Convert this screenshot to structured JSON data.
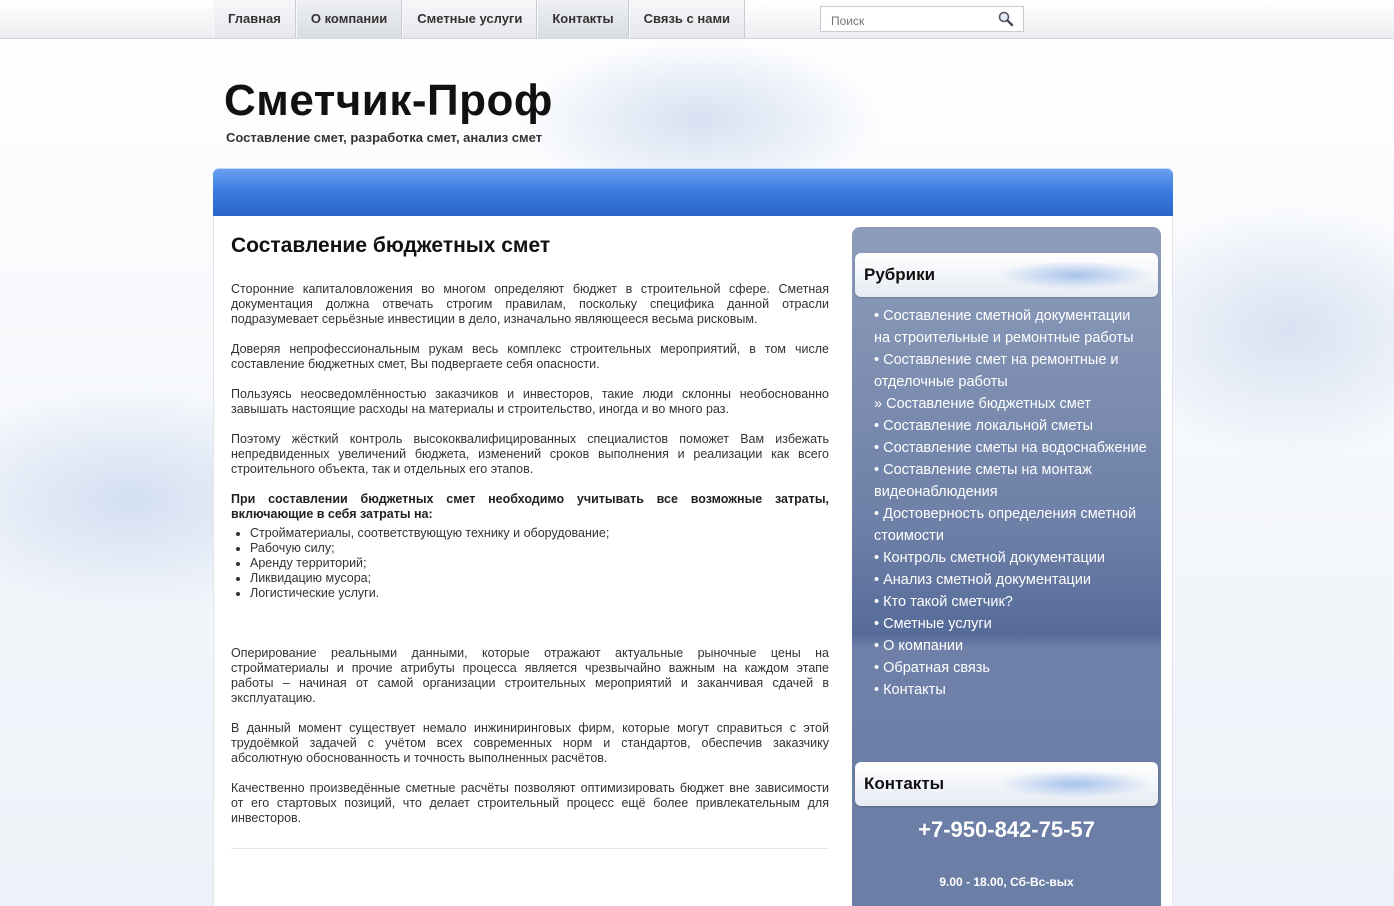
{
  "nav": {
    "items": [
      "Главная",
      "О компании",
      "Сметные услуги",
      "Контакты",
      "Связь с нами"
    ]
  },
  "search": {
    "placeholder": "Поиск"
  },
  "header": {
    "title": "Сметчик-Проф",
    "subtitle": "Составление смет, разработка смет, анализ смет"
  },
  "article": {
    "title": "Составление бюджетных смет",
    "p1": "Сторонние капиталовложения во многом определяют бюджет в строительной сфере. Сметная документация должна отвечать строгим правилам, поскольку специфика данной отрасли подразумевает серьёзные инвестиции в дело, изначально являющееся весьма рисковым.",
    "p2": "Доверяя непрофессиональным рукам весь комплекс строительных мероприятий, в том числе составление бюджетных смет, Вы подвергаете себя опасности.",
    "p3": "Пользуясь неосведомлённостью заказчиков и инвесторов, такие люди склонны необоснованно завышать настоящие расходы на материалы и строительство, иногда и во много раз.",
    "p4": "Поэтому жёсткий контроль высококвалифицированных специалистов поможет Вам избежать непредвиденных увеличений бюджета, изменений сроков выполнения и реализации как всего строительного объекта, так и отдельных его этапов.",
    "p5_bold": "При составлении бюджетных смет необходимо учитывать все возможные затраты, включающие в себя затраты на:",
    "list": [
      "Стройматериалы, соответствующую технику и оборудование;",
      "Рабочую силу;",
      "Аренду территорий;",
      "Ликвидацию мусора;",
      "Логистические услуги."
    ],
    "p6": "Оперирование реальными данными, которые отражают актуальные рыночные цены на стройматериалы и прочие атрибуты процесса является чрезвычайно важным на каждом этапе работы – начиная от самой организации строительных мероприятий и заканчивая сдачей в эксплуатацию.",
    "p7": "В данный момент существует немало инжиниринговых фирм, которые могут справиться с этой трудоёмкой задачей с учётом всех современных норм и стандартов, обеспечив заказчику абсолютную обоснованность и точность выполненных расчётов.",
    "p8": "Качественно произведённые сметные расчёты позволяют оптимизировать бюджет вне зависимости от его стартовых позиций, что делает строительный процесс ещё более привлекательным для инвесторов."
  },
  "sidebar": {
    "rubrics_title": "Рубрики",
    "rubrics": [
      "• Составление сметной документации на строительные и ремонтные работы",
      "• Составление смет на ремонтные и отделочные работы",
      "» Составление бюджетных смет",
      "• Составление локальной сметы",
      "• Составление сметы на водоснабжение",
      "• Составление сметы на монтаж видеонаблюдения",
      "• Достоверность определения сметной стоимости",
      "• Контроль сметной документации",
      "• Анализ сметной документации",
      "• Кто такой сметчик?",
      "• Сметные услуги",
      "• О компании",
      "• Обратная связь",
      "• Контакты"
    ],
    "contacts_title": "Контакты",
    "phone": "+7-950-842-75-57",
    "hours": "9.00 - 18.00, Сб-Вс-вых"
  }
}
